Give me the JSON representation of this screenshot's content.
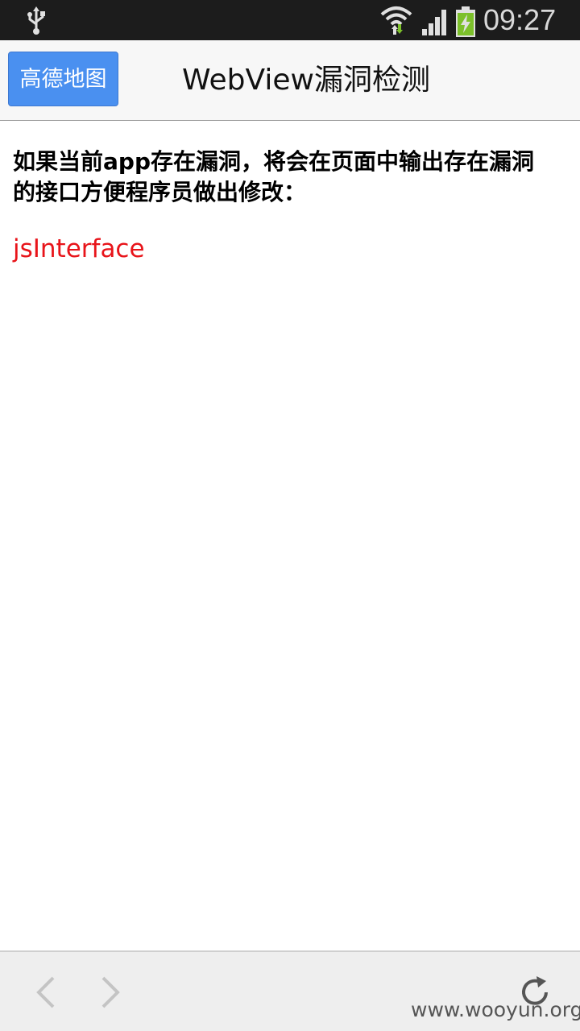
{
  "status_bar": {
    "time": "09:27",
    "icons": [
      "usb-icon",
      "wifi-icon",
      "signal-icon",
      "battery-charging-icon"
    ]
  },
  "header": {
    "amap_button_label": "高德地图",
    "title": "WebView漏洞检测",
    "colors": {
      "button_bg": "#4a90f0",
      "button_text": "#ffffff"
    }
  },
  "content": {
    "intro": "如果当前app存在漏洞，将会在页面中输出存在漏洞的接口方便程序员做出修改：",
    "interfaces": [
      "jsInterface"
    ],
    "colors": {
      "interface_text": "#e8141a"
    }
  },
  "toolbar": {
    "icons": [
      "back-arrow-icon",
      "forward-arrow-icon",
      "reload-icon"
    ],
    "watermark": "www.wooyun.org"
  }
}
